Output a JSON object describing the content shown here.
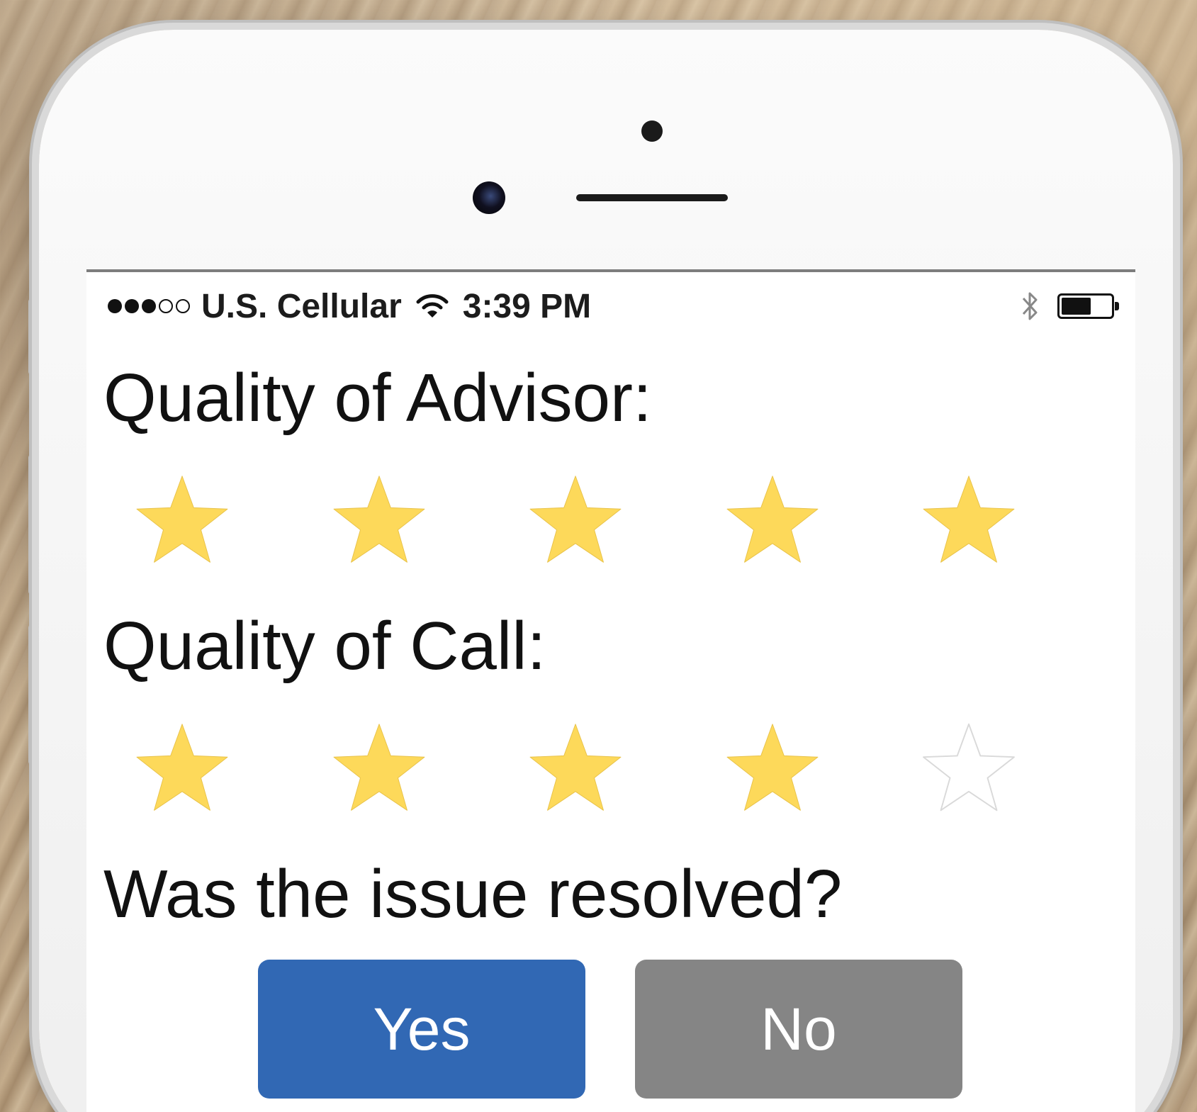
{
  "status_bar": {
    "signal_bars_filled": 3,
    "signal_bars_total": 5,
    "carrier": "U.S. Cellular",
    "time": "3:39 PM",
    "icons": [
      "wifi-icon",
      "bluetooth-icon",
      "battery-icon"
    ],
    "battery_level": 0.62
  },
  "questions": {
    "advisor": {
      "label": "Quality of Advisor:",
      "rating": 5,
      "max": 5
    },
    "call": {
      "label": "Quality of Call:",
      "rating": 4,
      "max": 5
    },
    "resolved": {
      "label": "Was the issue resolved?",
      "yes_label": "Yes",
      "no_label": "No"
    }
  },
  "colors": {
    "star_filled": "#fdd95a",
    "star_empty_stroke": "#d9d9d9",
    "yes_button": "#3168b4",
    "no_button": "#858585"
  }
}
